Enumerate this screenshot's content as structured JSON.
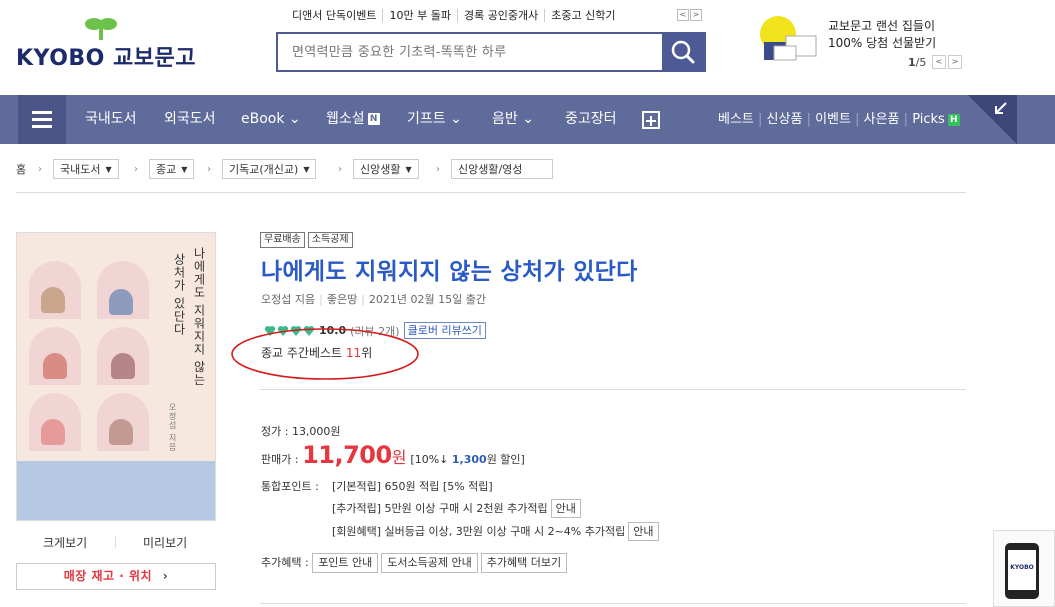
{
  "header": {
    "logo_text": "KYOBO 교보문고",
    "quick_links": [
      "디앤서 단독이벤트",
      "10만 부 돌파",
      "경록 공인중개사",
      "초중고 신학기"
    ],
    "search_placeholder": "면역력만큼 중요한 기초력-똑똑한 하루",
    "promo_line1": "교보문고 랜선 집들이",
    "promo_line2": "100% 당첨 선물받기",
    "promo_page_current": "1",
    "promo_page_total": "/5"
  },
  "nav": {
    "items": [
      "국내도서",
      "외국도서",
      "eBook",
      "웹소설",
      "기프트",
      "음반",
      "중고장터"
    ],
    "right_items": [
      "베스트",
      "신상품",
      "이벤트",
      "사은품",
      "Picks"
    ],
    "badge_n": "N",
    "badge_h": "H"
  },
  "breadcrumb": {
    "home": "홈",
    "items": [
      "국내도서",
      "종교",
      "기독교(개신교)",
      "신앙생활",
      "신앙생활/영성"
    ]
  },
  "cover": {
    "title_vertical": "나에게도 지워지지 않는",
    "title_vertical2": "상처가 있단다",
    "author_vertical": "오정섭 지음",
    "enlarge_label": "크게보기",
    "preview_label": "미리보기",
    "stock_label": "매장 재고 · 위치"
  },
  "product": {
    "tags": [
      "무료배송",
      "소득공제"
    ],
    "title": "나에게도 지워지지 않는 상처가 있단다",
    "author": "오정섭 지음",
    "publisher": "좋은땅",
    "pub_date": "2021년 02월 15일 출간",
    "rating_score": "10.0",
    "rating_count": "(리뷰 2개)",
    "review_button": "클로버 리뷰쓰기",
    "ranking_prefix": "종교 주간베스트 ",
    "ranking_num": "11",
    "ranking_suffix": "위"
  },
  "price": {
    "list_label": "정가 : 13,000원",
    "sale_label": "판매가 : ",
    "sale_value": "11,700",
    "sale_unit": "원",
    "discount_prefix": "[10%↓ ",
    "discount_amount": "1,300",
    "discount_suffix": "원 할인]",
    "points_label": "통합포인트 : ",
    "points_basic": "[기본적립] 650원 적립 [5% 적립]",
    "points_extra": "[추가적립] 5만원 이상 구매 시 2천원 추가적립",
    "points_member": "[회원혜택] 실버등급 이상, 3만원 이상 구매 시 2~4% 추가적립",
    "guide_label": "안내",
    "benefit_label": "추가혜택 : ",
    "benefit_buttons": [
      "포인트 안내",
      "도서소득공제 안내",
      "추가혜택 더보기"
    ]
  },
  "side_widget": {
    "logo": "KYOBO"
  },
  "colors": {
    "nav_bg": "#5f6b9b",
    "title": "#2a5ac7",
    "price_red": "#e4373f",
    "brand_green": "#6cc24a"
  }
}
